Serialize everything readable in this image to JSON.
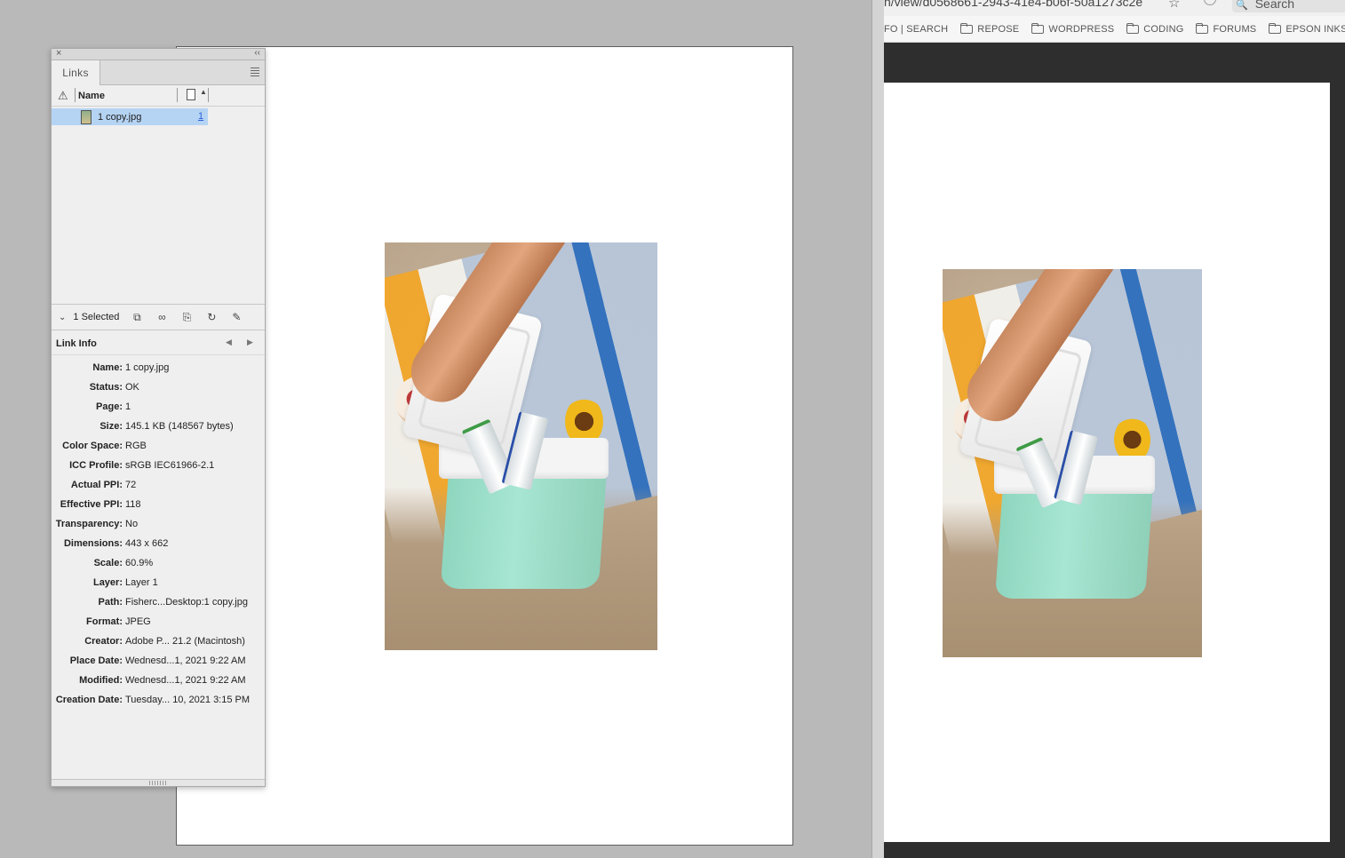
{
  "links_panel": {
    "tab_label": "Links",
    "close_glyph": "×",
    "collapse_glyph": "‹‹",
    "column_name_label": "Name",
    "links": [
      {
        "filename": "1 copy.jpg",
        "page": "1"
      }
    ],
    "selection_label": "1 Selected",
    "link_info_title": "Link Info",
    "link_info": [
      {
        "key": "Name:",
        "value": "1 copy.jpg"
      },
      {
        "key": "Status:",
        "value": "OK"
      },
      {
        "key": "Page:",
        "value": "1"
      },
      {
        "key": "Size:",
        "value": "145.1 KB (148567 bytes)"
      },
      {
        "key": "Color Space:",
        "value": "RGB"
      },
      {
        "key": "ICC Profile:",
        "value": "sRGB IEC61966-2.1"
      },
      {
        "key": "Actual PPI:",
        "value": "72"
      },
      {
        "key": "Effective PPI:",
        "value": "118"
      },
      {
        "key": "Transparency:",
        "value": "No"
      },
      {
        "key": "Dimensions:",
        "value": "443 x 662"
      },
      {
        "key": "Scale:",
        "value": "60.9%"
      },
      {
        "key": "Layer:",
        "value": "Layer 1"
      },
      {
        "key": "Path:",
        "value": "Fisherc...Desktop:1 copy.jpg"
      },
      {
        "key": "Format:",
        "value": "JPEG"
      },
      {
        "key": "Creator:",
        "value": "Adobe P... 21.2 (Macintosh)"
      },
      {
        "key": "Place Date:",
        "value": "Wednesd...1, 2021 9:22 AM"
      },
      {
        "key": "Modified:",
        "value": "Wednesd...1, 2021 9:22 AM"
      },
      {
        "key": "Creation Date:",
        "value": "Tuesday... 10, 2021 3:15 PM"
      }
    ]
  },
  "browser": {
    "url": "n/view/d0568661-2943-41e4-b06f-50a1273c2e",
    "search_placeholder": "Search",
    "bookmarks": [
      "FO | SEARCH",
      "REPOSE",
      "WORDPRESS",
      "CODING",
      "FORUMS",
      "EPSON INKS"
    ]
  },
  "icons": {
    "warning": "warning-icon",
    "page": "page-icon",
    "relink": "relink-from-folder-icon",
    "goto_link": "go-to-link-icon",
    "update": "update-link-icon",
    "refresh": "refresh-icon",
    "edit": "edit-original-icon"
  },
  "colors": {
    "selection": "#b5d4f3",
    "page_link": "#2b5fd9",
    "viewer_bg": "#2e2e2e"
  }
}
